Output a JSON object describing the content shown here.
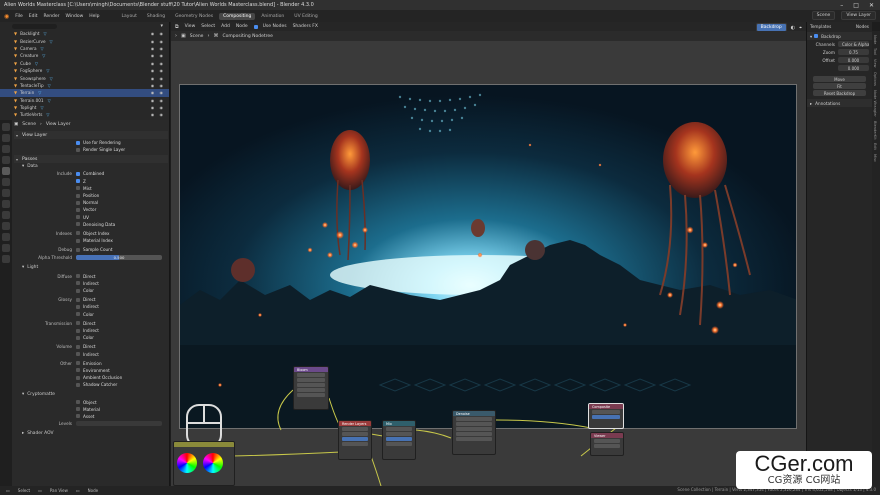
{
  "window": {
    "title": "Alien Worlds Masterclass [C:\\Users\\mingh\\Documents\\Blender stuff\\20 Tutor\\Alien Worlds Masterclass.blend] - Blender 4.3.0"
  },
  "menu": {
    "items": [
      "File",
      "Edit",
      "Render",
      "Window",
      "Help"
    ],
    "workspaces": [
      "Layout",
      "Shading",
      "Geometry Nodes",
      "Compositing",
      "Animation",
      "UV Editing"
    ],
    "active_workspace": "Compositing",
    "scene_label": "Scene",
    "view_layer_label": "View Layer"
  },
  "outliner": {
    "search_placeholder": "",
    "items": [
      {
        "name": "Backlight",
        "selected": false
      },
      {
        "name": "BezierCurve",
        "selected": false
      },
      {
        "name": "Camera",
        "selected": false
      },
      {
        "name": "Creature",
        "selected": false
      },
      {
        "name": "Cube",
        "selected": false
      },
      {
        "name": "FogSphere",
        "selected": false
      },
      {
        "name": "Snowsphere",
        "selected": false
      },
      {
        "name": "TentacleTip",
        "selected": false
      },
      {
        "name": "Terrain",
        "selected": true
      },
      {
        "name": "Terrain.001",
        "selected": false
      },
      {
        "name": "Toplight",
        "selected": false
      },
      {
        "name": "TurtleVerts",
        "selected": false
      },
      {
        "name": "Volume",
        "selected": false
      }
    ]
  },
  "properties": {
    "breadcrumb": {
      "scene": "Scene",
      "view_layer": "View Layer"
    },
    "view_layer_panel": "View Layer",
    "use_for_rendering": "Use for Rendering",
    "render_single_layer": "Render Single Layer",
    "passes_panel": "Passes",
    "data_sub": "Data",
    "include_label": "Include",
    "data_passes": [
      {
        "label": "Combined",
        "on": true
      },
      {
        "label": "Z",
        "on": true
      },
      {
        "label": "Mist",
        "on": false
      },
      {
        "label": "Position",
        "on": false
      },
      {
        "label": "Normal",
        "on": false
      },
      {
        "label": "Vector",
        "on": false
      },
      {
        "label": "UV",
        "on": false
      },
      {
        "label": "Denoising Data",
        "on": false
      }
    ],
    "indexes_label": "Indexes",
    "index_passes": [
      {
        "label": "Object Index",
        "on": false
      },
      {
        "label": "Material Index",
        "on": false
      }
    ],
    "debug_label": "Debug",
    "debug_passes": [
      {
        "label": "Sample Count",
        "on": false
      }
    ],
    "alpha_threshold_label": "Alpha Threshold",
    "alpha_threshold_value": "0.500",
    "alpha_threshold_fraction": 0.5,
    "light_sub": "Light",
    "light_groups": [
      {
        "label": "Diffuse",
        "items": [
          "Direct",
          "Indirect",
          "Color"
        ]
      },
      {
        "label": "Glossy",
        "items": [
          "Direct",
          "Indirect",
          "Color"
        ]
      },
      {
        "label": "Transmission",
        "items": [
          "Direct",
          "Indirect",
          "Color"
        ]
      },
      {
        "label": "Volume",
        "items": [
          "Direct",
          "Indirect"
        ]
      },
      {
        "label": "Other",
        "items": [
          "Emission",
          "Environment",
          "Ambient Occlusion",
          "Shadow Catcher"
        ]
      }
    ],
    "cryptomatte_sub": "Cryptomatte",
    "crypto_items": [
      "Object",
      "Material",
      "Asset"
    ],
    "levels_label": "Levels",
    "shader_aov_sub": "Shader AOV"
  },
  "compositor": {
    "menu": [
      "View",
      "Select",
      "Add",
      "Node"
    ],
    "backdrop_label": "Backdrop",
    "shaders_fx_label": "Shaders FX",
    "use_nodes_label": "Use Nodes",
    "breadcrumb_scene": "Scene",
    "breadcrumb_tree": "Compositing Nodetree",
    "nodes": [
      {
        "title": "Bloom"
      },
      {
        "title": "Render Layers"
      },
      {
        "title": "Mix"
      },
      {
        "title": "Denoise"
      },
      {
        "title": "Composite"
      },
      {
        "title": "Viewer"
      }
    ]
  },
  "sidebar": {
    "templates_label": "Templates",
    "nodes_label": "Nodes",
    "backdrop_panel": "Backdrop",
    "channels_label": "Channels",
    "channels_value": "Color & Alpha",
    "zoom_label": "Zoom",
    "zoom_value": "0.75",
    "offset_label": "Offset",
    "offset_x": "0.000",
    "offset_y": "0.000",
    "move_button": "Move",
    "fit_button": "Fit",
    "reset_button": "Reset Backdrop",
    "annotations_panel": "Annotations",
    "tabs": [
      "Node",
      "Tool",
      "View",
      "Options",
      "Node Wrangler",
      "BlenderKit",
      "Edit",
      "Misc"
    ]
  },
  "statusbar": {
    "select": "Select",
    "pan": "Pan View",
    "nodes": "Node",
    "right_info": "Scene Collection | Terrain | Verts 2,347,354 | Faces 2,326,284 | Tris 4,652,568 | Objects 1/13 | 4.3.0"
  },
  "watermark": {
    "big": "CGer.com",
    "small": "CG资源 CG网站"
  },
  "colors": {
    "accent": "#4772b3",
    "selected_row": "#334d80",
    "object_icon": "#f2a444"
  }
}
